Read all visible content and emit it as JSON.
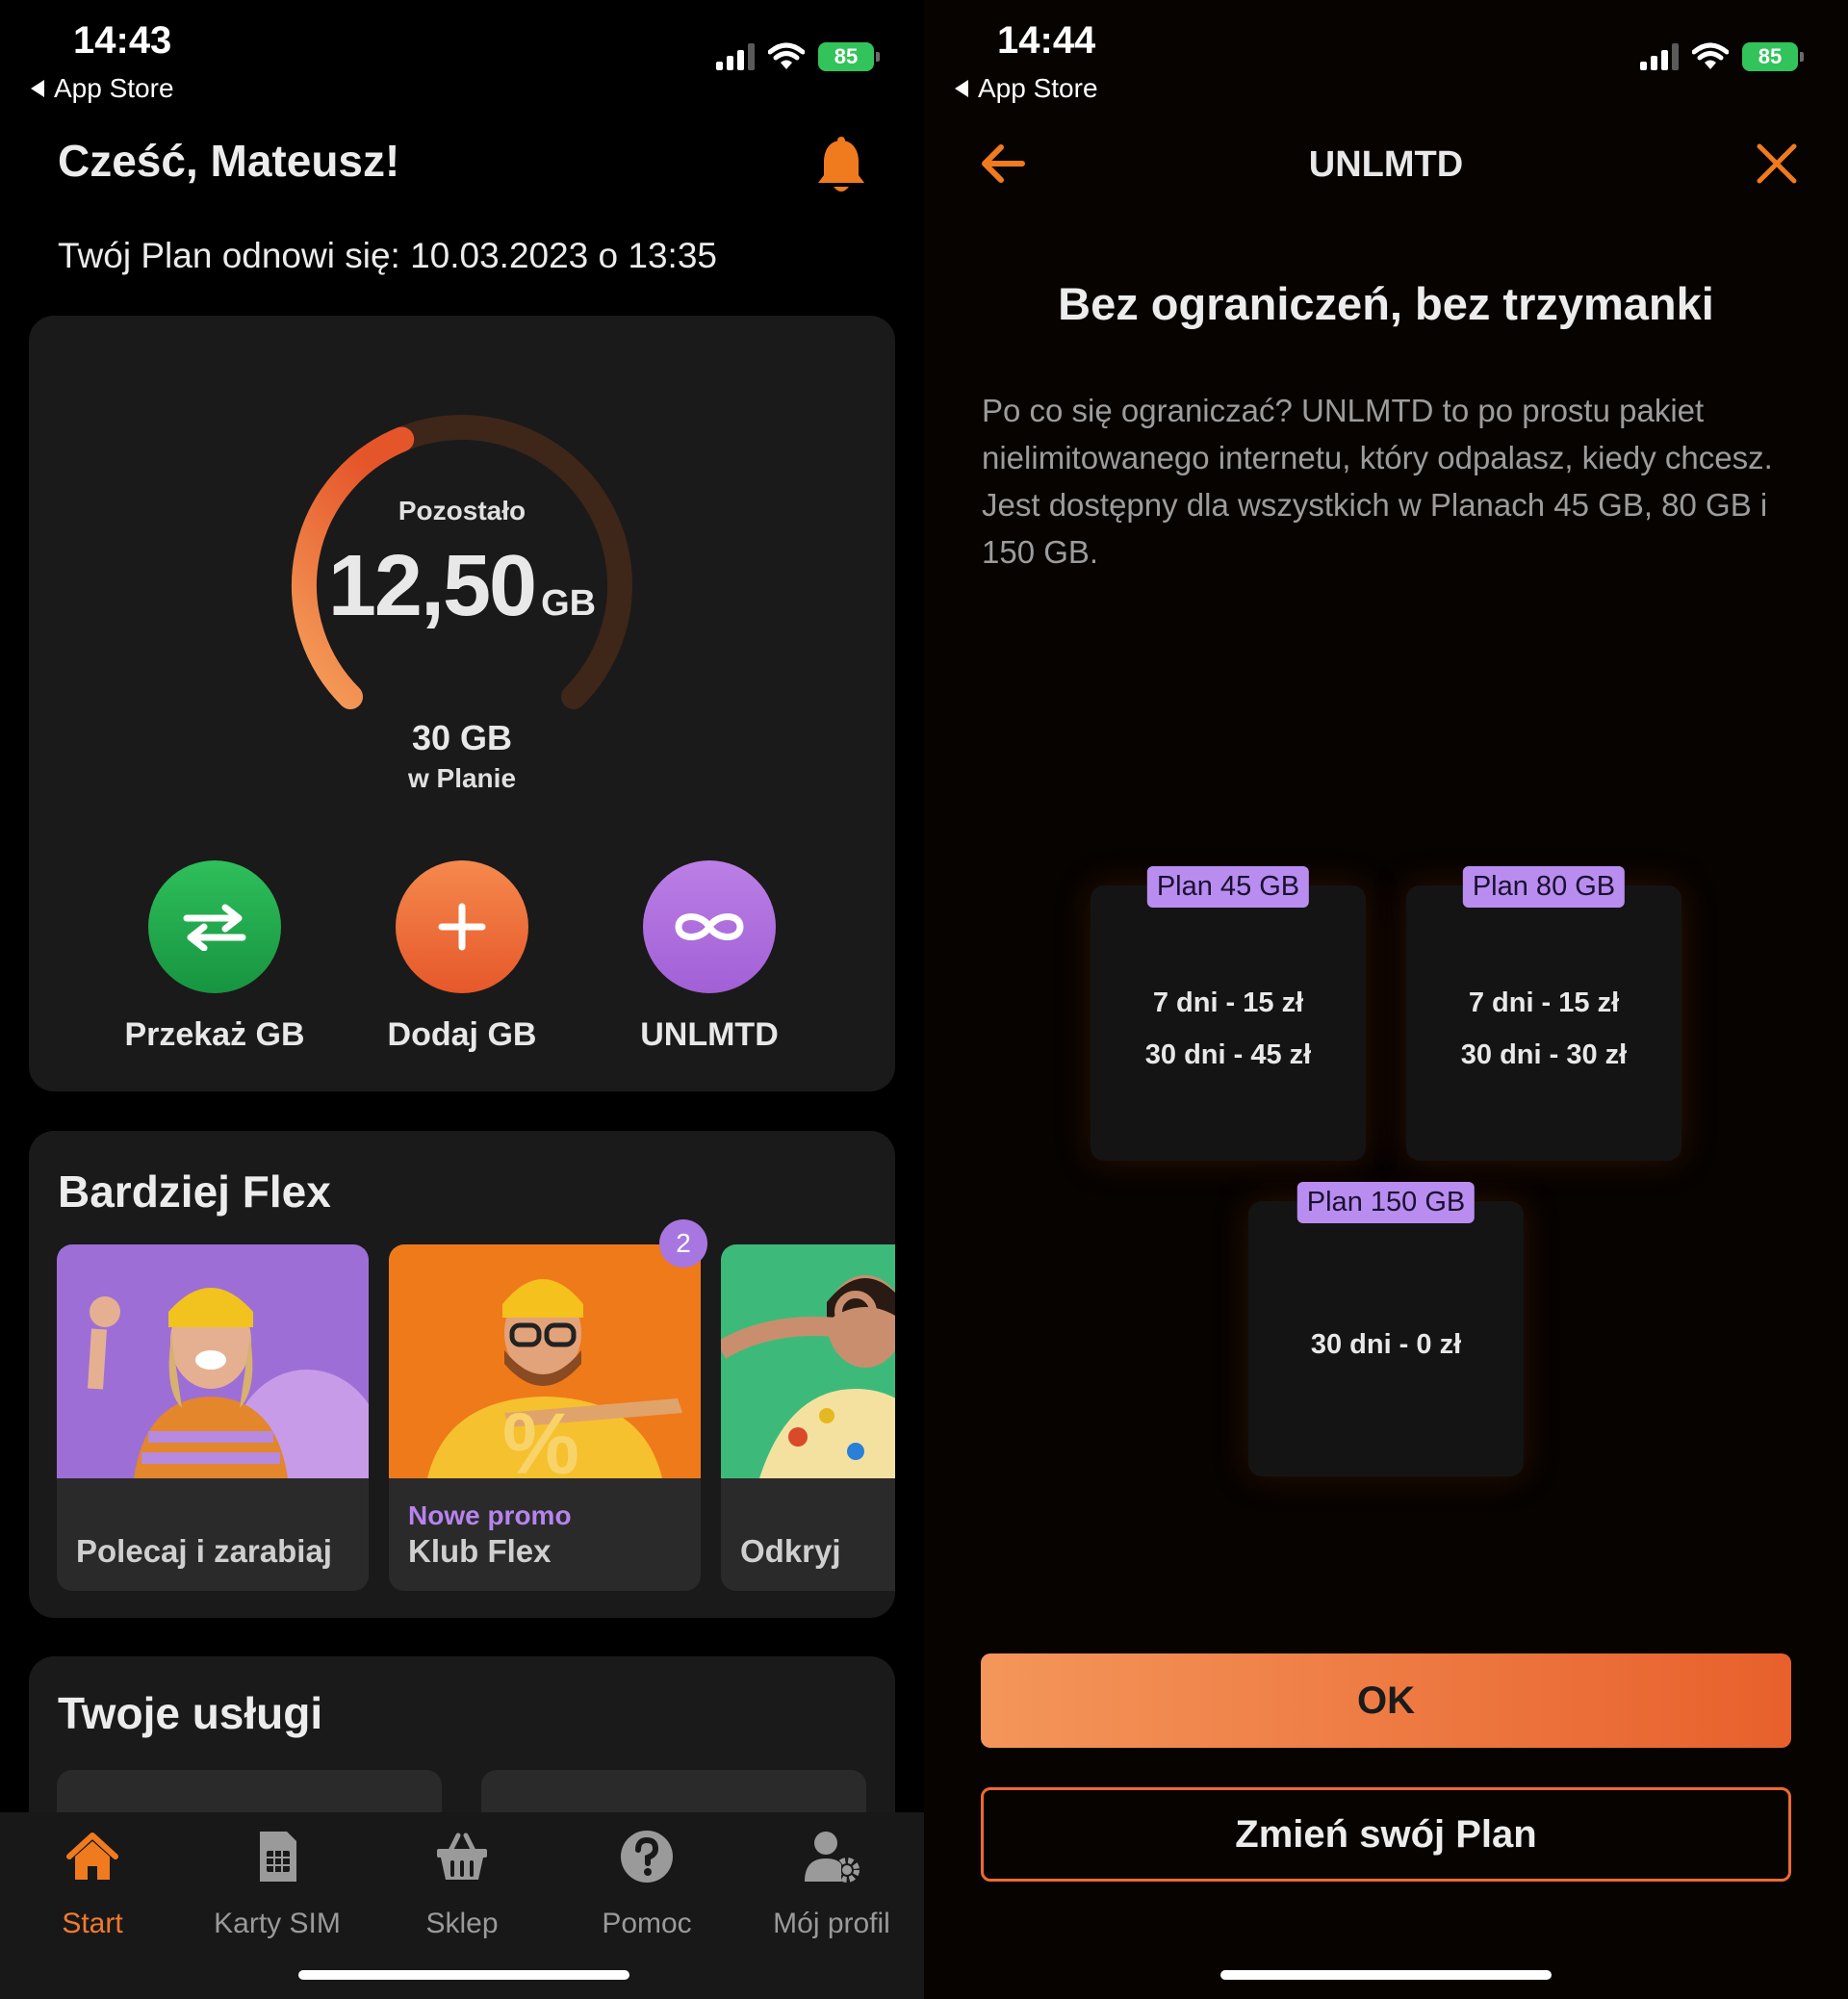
{
  "left_screen": {
    "status_bar": {
      "time": "14:43",
      "back_label": "App Store",
      "battery": "85"
    },
    "greeting": "Cześć, Mateusz!",
    "renewal_text": "Twój Plan odnowi się: 10.03.2023 o 13:35",
    "data_gauge": {
      "remaining_label": "Pozostało",
      "remaining_value": "12,50",
      "remaining_unit": "GB",
      "total_value": "30 GB",
      "total_label": "w Planie",
      "remaining_fraction": 0.4167,
      "colors": {
        "progress_start": "#f5a05c",
        "progress_end": "#e5552a",
        "track": "#3e2619"
      }
    },
    "actions": [
      {
        "label": "Przekaż GB",
        "icon": "transfer-arrows-icon",
        "color": "#22a84c"
      },
      {
        "label": "Dodaj GB",
        "icon": "plus-icon",
        "color": "#ee6c36"
      },
      {
        "label": "UNLMTD",
        "icon": "infinity-icon",
        "color": "#ad6fe0"
      }
    ],
    "flex_section": {
      "title": "Bardziej Flex",
      "tiles": [
        {
          "label": "Polecaj i zarabiaj",
          "promo": "",
          "image": "woman-purple-sweater-photo",
          "bg": "#9d6fd6"
        },
        {
          "label": "Klub Flex",
          "promo": "Nowe promo",
          "badge": "2",
          "image": "man-yellow-shirt-percent-photo",
          "bg": "#ef7a1a"
        },
        {
          "label": "Odkryj",
          "promo": "",
          "image": "woman-green-background-photo",
          "bg": "#3dba7a"
        }
      ]
    },
    "services_section": {
      "title": "Twoje usługi"
    },
    "tab_bar": [
      {
        "label": "Start",
        "icon": "home-icon",
        "active": true
      },
      {
        "label": "Karty SIM",
        "icon": "sim-card-icon",
        "active": false
      },
      {
        "label": "Sklep",
        "icon": "basket-icon",
        "active": false
      },
      {
        "label": "Pomoc",
        "icon": "help-icon",
        "active": false
      },
      {
        "label": "Mój profil",
        "icon": "profile-settings-icon",
        "active": false
      }
    ]
  },
  "right_screen": {
    "status_bar": {
      "time": "14:44",
      "back_label": "App Store",
      "battery": "85"
    },
    "nav_title": "UNLMTD",
    "heading": "Bez ograniczeń, bez trzymanki",
    "description": "Po co się ograniczać? UNLMTD to po prostu pakiet nielimitowanego internetu, który odpalasz, kiedy chcesz. Jest dostępny dla wszystkich w Planach 45 GB, 80 GB i 150 GB.",
    "plans": [
      {
        "tag": "Plan 45 GB",
        "lines": [
          "7 dni - 15 zł",
          "30 dni - 45 zł"
        ]
      },
      {
        "tag": "Plan 80 GB",
        "lines": [
          "7 dni - 15 zł",
          "30 dni - 30 zł"
        ]
      },
      {
        "tag": "Plan 150 GB",
        "lines": [
          "30 dni - 0 zł"
        ]
      }
    ],
    "ok_button": "OK",
    "change_plan_button": "Zmień swój Plan",
    "accent_color": "#ee6c36",
    "tag_color": "#b98df0"
  }
}
